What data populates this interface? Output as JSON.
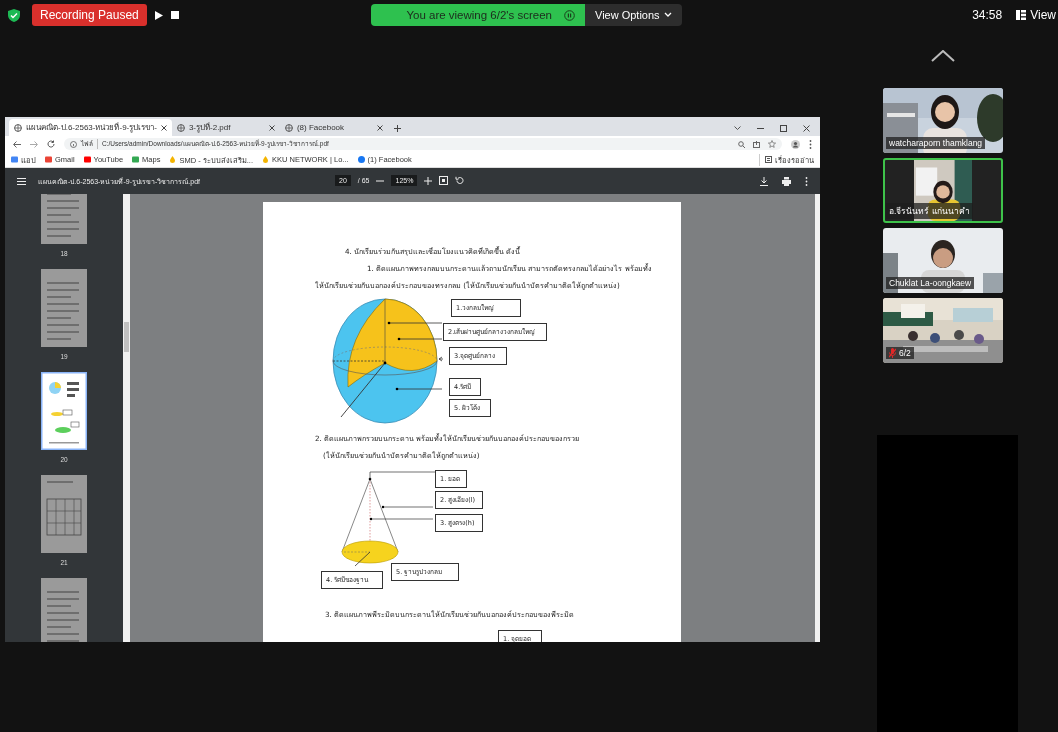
{
  "meeting_bar": {
    "recording_status": "Recording Paused",
    "viewing_banner": "You are viewing 6/2's screen",
    "view_options": "View Options",
    "timer": "34:58",
    "view_button": "View"
  },
  "browser": {
    "tabs": [
      {
        "title": "แผนคณิต-ป.6-2563-หน่วยที่-9-รูปเรขา-",
        "selected": true
      },
      {
        "title": "3-รูปที่-2.pdf",
        "selected": false
      },
      {
        "title": "(8) Facebook",
        "selected": false
      }
    ],
    "address": {
      "scheme": "ไฟล์",
      "url": "C:/Users/admin/Downloads/แผนคณิต-ป.6-2563-หน่วยที่-9-รูปเรขา-วิชาการณ์.pdf"
    },
    "bookmarks": [
      {
        "title": "แอป",
        "kind": "apps"
      },
      {
        "title": "Gmail",
        "kind": "gmail"
      },
      {
        "title": "YouTube",
        "kind": "youtube"
      },
      {
        "title": "Maps",
        "kind": "maps"
      },
      {
        "title": "SMD - ระบบส่งเสริม...",
        "kind": "folder"
      },
      {
        "title": "KKU NETWORK | Lo...",
        "kind": "folder"
      },
      {
        "title": "(1) Facebook",
        "kind": "facebook"
      }
    ],
    "reading_list": "เรื่องรออ่าน"
  },
  "pdf_viewer": {
    "file_name": "แผนคณิต-ป.6-2563-หน่วยที่-9-รูปเรขา-วิชาการณ์.pdf",
    "page": "20",
    "page_total": "/ 65",
    "zoom": "125%",
    "thumbnails": [
      {
        "label": "18",
        "kind": "text",
        "selected": false
      },
      {
        "label": "19",
        "kind": "text",
        "selected": false
      },
      {
        "label": "20",
        "kind": "diagram",
        "selected": true
      },
      {
        "label": "21",
        "kind": "table",
        "selected": false
      },
      {
        "kind": "text",
        "selected": false
      }
    ],
    "document": {
      "heading": "4.  นักเรียนร่วมกันสรุปและเชื่อมโยงแนวคิดที่เกิดขึ้น ดังนี้",
      "sections": [
        {
          "kind": "sphere",
          "lines": [
            "1. ติดแผนภาพทรงกลมบนกระดานแล้วถามนักเรียน สามารถตัดทรงกลมได้อย่างไร พร้อมทั้ง",
            "ให้นักเรียนช่วยกันบอกองค์ประกอบของทรงกลม (ให้นักเรียนช่วยกันนำบัตรคำมาติดให้ถูกตำแหน่ง)"
          ],
          "labels": [
            "1.วงกลมใหญ่",
            "2.เส้นผ่านศูนย์กลางวงกลมใหญ่",
            "3.จุดศูนย์กลาง",
            "4.รัศมี",
            "5. ผิวโค้ง"
          ]
        },
        {
          "kind": "cone",
          "lines": [
            "2. ติดแผนภาพกรวยบนกระดาน พร้อมทั้งให้นักเรียนช่วยกันบอกองค์ประกอบของกรวย",
            "(ให้นักเรียนช่วยกันนำบัตรคำมาติดให้ถูกตำแหน่ง)"
          ],
          "labels": [
            "1. ยอด",
            "2. สูงเอียง(l)",
            "3. สูงตรง(h)",
            "4. รัศมีของฐาน",
            "5. ฐานรูปวงกลม"
          ]
        },
        {
          "kind": "pyramid",
          "lines": [
            "3. ติดแผนภาพพีระมิดบนกระดานให้นักเรียนช่วยกันบอกองค์ประกอบของพีระมิด"
          ],
          "labels": [
            "1. จุดยอด"
          ]
        }
      ]
    }
  },
  "participants": [
    {
      "name": "watcharaporn thamklang",
      "speaking": false,
      "muted": false
    },
    {
      "name": "อ.จีรนันทร์ แก่นนาคำ",
      "speaking": true,
      "muted": false
    },
    {
      "name": "Chuklat La-oongkaew",
      "speaking": false,
      "muted": false
    },
    {
      "name": "6/2",
      "speaking": false,
      "muted": true
    }
  ]
}
